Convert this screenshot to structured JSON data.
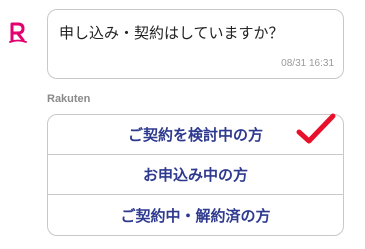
{
  "avatar": {
    "letter": "R",
    "color": "#e4006f"
  },
  "message": {
    "text": "申し込み・契約はしていますか？",
    "time": "08/31 16:31"
  },
  "sender": "Rakuten",
  "options": [
    {
      "label": "ご契約を検討中の方"
    },
    {
      "label": "お申込み中の方"
    },
    {
      "label": "ご契約中・解約済の方"
    }
  ],
  "annotation": {
    "icon": "checkmark-icon",
    "color": "#e8102a",
    "marks_option": 0
  }
}
